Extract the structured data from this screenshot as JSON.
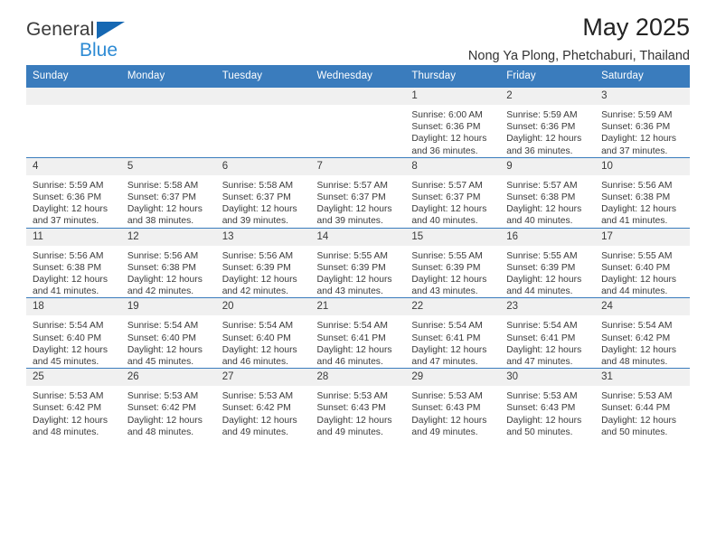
{
  "brand": {
    "name_top": "General",
    "name_bottom": "Blue",
    "triangle_color": "#1668b3",
    "bottom_color": "#2e8bd4"
  },
  "header": {
    "title": "May 2025",
    "subtitle": "Nong Ya Plong, Phetchaburi, Thailand",
    "accent_color": "#3a7cbd"
  },
  "calendar": {
    "weekday_headers": [
      "Sunday",
      "Monday",
      "Tuesday",
      "Wednesday",
      "Thursday",
      "Friday",
      "Saturday"
    ],
    "labels": {
      "sunrise": "Sunrise:",
      "sunset": "Sunset:",
      "daylight": "Daylight:"
    },
    "weeks": [
      [
        {
          "day": "",
          "blank": true
        },
        {
          "day": "",
          "blank": true
        },
        {
          "day": "",
          "blank": true
        },
        {
          "day": "",
          "blank": true
        },
        {
          "day": "1",
          "sunrise": "Sunrise: 6:00 AM",
          "sunset": "Sunset: 6:36 PM",
          "daylight": "Daylight: 12 hours and 36 minutes."
        },
        {
          "day": "2",
          "sunrise": "Sunrise: 5:59 AM",
          "sunset": "Sunset: 6:36 PM",
          "daylight": "Daylight: 12 hours and 36 minutes."
        },
        {
          "day": "3",
          "sunrise": "Sunrise: 5:59 AM",
          "sunset": "Sunset: 6:36 PM",
          "daylight": "Daylight: 12 hours and 37 minutes."
        }
      ],
      [
        {
          "day": "4",
          "sunrise": "Sunrise: 5:59 AM",
          "sunset": "Sunset: 6:36 PM",
          "daylight": "Daylight: 12 hours and 37 minutes."
        },
        {
          "day": "5",
          "sunrise": "Sunrise: 5:58 AM",
          "sunset": "Sunset: 6:37 PM",
          "daylight": "Daylight: 12 hours and 38 minutes."
        },
        {
          "day": "6",
          "sunrise": "Sunrise: 5:58 AM",
          "sunset": "Sunset: 6:37 PM",
          "daylight": "Daylight: 12 hours and 39 minutes."
        },
        {
          "day": "7",
          "sunrise": "Sunrise: 5:57 AM",
          "sunset": "Sunset: 6:37 PM",
          "daylight": "Daylight: 12 hours and 39 minutes."
        },
        {
          "day": "8",
          "sunrise": "Sunrise: 5:57 AM",
          "sunset": "Sunset: 6:37 PM",
          "daylight": "Daylight: 12 hours and 40 minutes."
        },
        {
          "day": "9",
          "sunrise": "Sunrise: 5:57 AM",
          "sunset": "Sunset: 6:38 PM",
          "daylight": "Daylight: 12 hours and 40 minutes."
        },
        {
          "day": "10",
          "sunrise": "Sunrise: 5:56 AM",
          "sunset": "Sunset: 6:38 PM",
          "daylight": "Daylight: 12 hours and 41 minutes."
        }
      ],
      [
        {
          "day": "11",
          "sunrise": "Sunrise: 5:56 AM",
          "sunset": "Sunset: 6:38 PM",
          "daylight": "Daylight: 12 hours and 41 minutes."
        },
        {
          "day": "12",
          "sunrise": "Sunrise: 5:56 AM",
          "sunset": "Sunset: 6:38 PM",
          "daylight": "Daylight: 12 hours and 42 minutes."
        },
        {
          "day": "13",
          "sunrise": "Sunrise: 5:56 AM",
          "sunset": "Sunset: 6:39 PM",
          "daylight": "Daylight: 12 hours and 42 minutes."
        },
        {
          "day": "14",
          "sunrise": "Sunrise: 5:55 AM",
          "sunset": "Sunset: 6:39 PM",
          "daylight": "Daylight: 12 hours and 43 minutes."
        },
        {
          "day": "15",
          "sunrise": "Sunrise: 5:55 AM",
          "sunset": "Sunset: 6:39 PM",
          "daylight": "Daylight: 12 hours and 43 minutes."
        },
        {
          "day": "16",
          "sunrise": "Sunrise: 5:55 AM",
          "sunset": "Sunset: 6:39 PM",
          "daylight": "Daylight: 12 hours and 44 minutes."
        },
        {
          "day": "17",
          "sunrise": "Sunrise: 5:55 AM",
          "sunset": "Sunset: 6:40 PM",
          "daylight": "Daylight: 12 hours and 44 minutes."
        }
      ],
      [
        {
          "day": "18",
          "sunrise": "Sunrise: 5:54 AM",
          "sunset": "Sunset: 6:40 PM",
          "daylight": "Daylight: 12 hours and 45 minutes."
        },
        {
          "day": "19",
          "sunrise": "Sunrise: 5:54 AM",
          "sunset": "Sunset: 6:40 PM",
          "daylight": "Daylight: 12 hours and 45 minutes."
        },
        {
          "day": "20",
          "sunrise": "Sunrise: 5:54 AM",
          "sunset": "Sunset: 6:40 PM",
          "daylight": "Daylight: 12 hours and 46 minutes."
        },
        {
          "day": "21",
          "sunrise": "Sunrise: 5:54 AM",
          "sunset": "Sunset: 6:41 PM",
          "daylight": "Daylight: 12 hours and 46 minutes."
        },
        {
          "day": "22",
          "sunrise": "Sunrise: 5:54 AM",
          "sunset": "Sunset: 6:41 PM",
          "daylight": "Daylight: 12 hours and 47 minutes."
        },
        {
          "day": "23",
          "sunrise": "Sunrise: 5:54 AM",
          "sunset": "Sunset: 6:41 PM",
          "daylight": "Daylight: 12 hours and 47 minutes."
        },
        {
          "day": "24",
          "sunrise": "Sunrise: 5:54 AM",
          "sunset": "Sunset: 6:42 PM",
          "daylight": "Daylight: 12 hours and 48 minutes."
        }
      ],
      [
        {
          "day": "25",
          "sunrise": "Sunrise: 5:53 AM",
          "sunset": "Sunset: 6:42 PM",
          "daylight": "Daylight: 12 hours and 48 minutes."
        },
        {
          "day": "26",
          "sunrise": "Sunrise: 5:53 AM",
          "sunset": "Sunset: 6:42 PM",
          "daylight": "Daylight: 12 hours and 48 minutes."
        },
        {
          "day": "27",
          "sunrise": "Sunrise: 5:53 AM",
          "sunset": "Sunset: 6:42 PM",
          "daylight": "Daylight: 12 hours and 49 minutes."
        },
        {
          "day": "28",
          "sunrise": "Sunrise: 5:53 AM",
          "sunset": "Sunset: 6:43 PM",
          "daylight": "Daylight: 12 hours and 49 minutes."
        },
        {
          "day": "29",
          "sunrise": "Sunrise: 5:53 AM",
          "sunset": "Sunset: 6:43 PM",
          "daylight": "Daylight: 12 hours and 49 minutes."
        },
        {
          "day": "30",
          "sunrise": "Sunrise: 5:53 AM",
          "sunset": "Sunset: 6:43 PM",
          "daylight": "Daylight: 12 hours and 50 minutes."
        },
        {
          "day": "31",
          "sunrise": "Sunrise: 5:53 AM",
          "sunset": "Sunset: 6:44 PM",
          "daylight": "Daylight: 12 hours and 50 minutes."
        }
      ]
    ]
  }
}
